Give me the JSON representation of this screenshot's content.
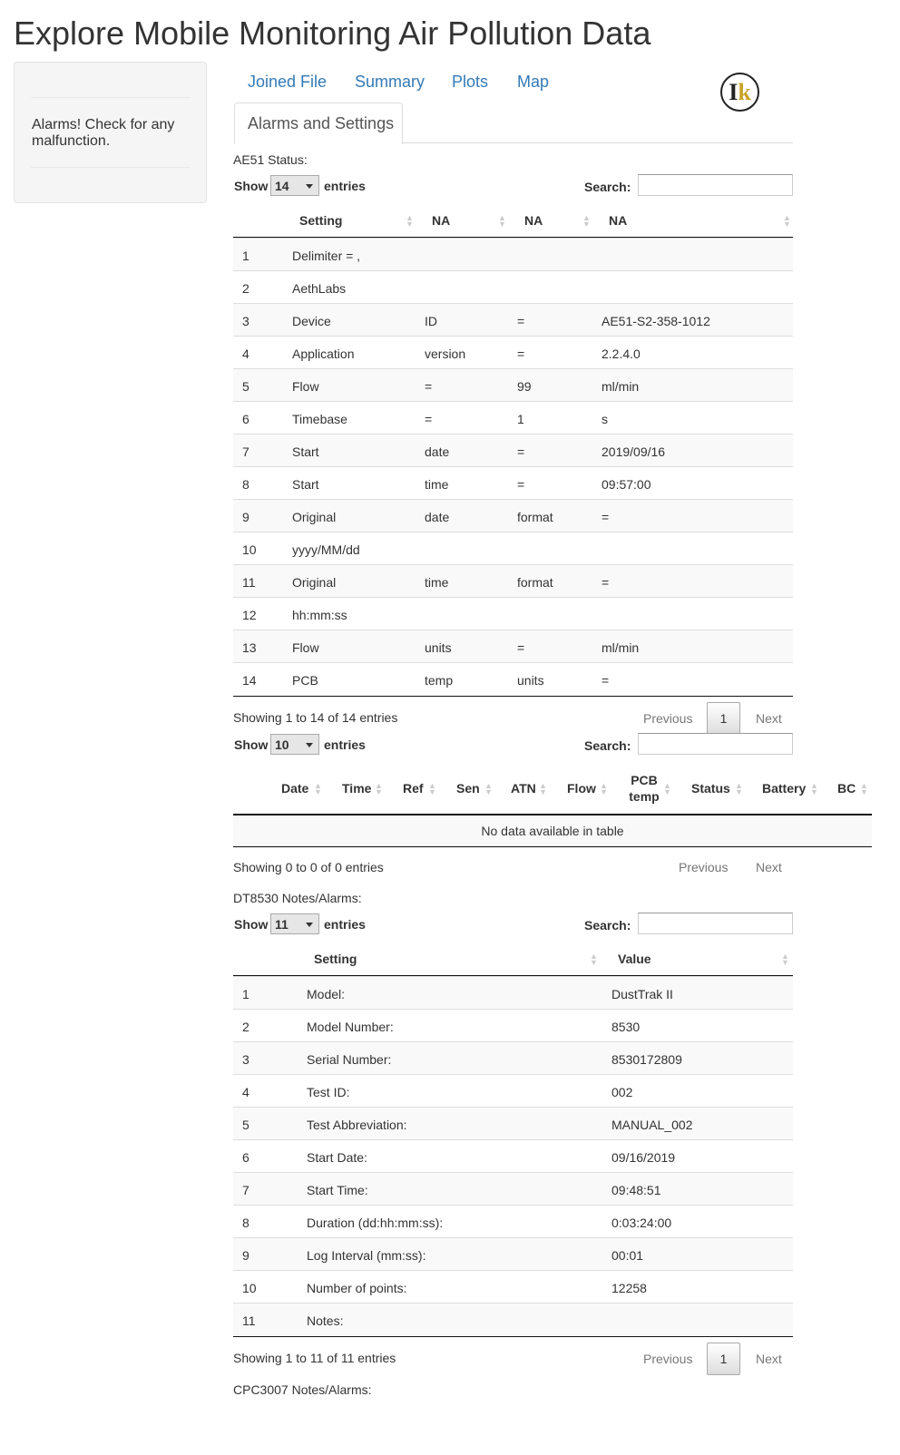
{
  "title": "Explore Mobile Monitoring Air Pollution Data",
  "sidebar": {
    "alarm_text": "Alarms! Check for any malfunction."
  },
  "nav": {
    "tabs": [
      "Joined File",
      "Summary",
      "Plots",
      "Map"
    ],
    "active_tab": "Alarms and Settings"
  },
  "labels": {
    "show": "Show",
    "entries": "entries",
    "search": "Search:",
    "previous": "Previous",
    "next": "Next",
    "page": "1"
  },
  "ae51": {
    "heading": "AE51 Status:",
    "page_length": "14",
    "columns": [
      "Setting",
      "NA",
      "NA",
      "NA"
    ],
    "rows": [
      [
        "1",
        "Delimiter = ,",
        "",
        "",
        ""
      ],
      [
        "2",
        "AethLabs",
        "",
        "",
        ""
      ],
      [
        "3",
        "Device",
        "ID",
        "=",
        "AE51-S2-358-1012"
      ],
      [
        "4",
        "Application",
        "version",
        "=",
        "2.2.4.0"
      ],
      [
        "5",
        "Flow",
        "=",
        "99",
        "ml/min"
      ],
      [
        "6",
        "Timebase",
        "=",
        "1",
        "s"
      ],
      [
        "7",
        "Start",
        "date",
        "=",
        "2019/09/16"
      ],
      [
        "8",
        "Start",
        "time",
        "=",
        "09:57:00"
      ],
      [
        "9",
        "Original",
        "date",
        "format",
        "="
      ],
      [
        "10",
        "yyyy/MM/dd",
        "",
        "",
        ""
      ],
      [
        "11",
        "Original",
        "time",
        "format",
        "="
      ],
      [
        "12",
        "hh:mm:ss",
        "",
        "",
        ""
      ],
      [
        "13",
        "Flow",
        "units",
        "=",
        "ml/min"
      ],
      [
        "14",
        "PCB",
        "temp",
        "units",
        "="
      ]
    ],
    "info": "Showing 1 to 14 of 14 entries"
  },
  "data_table": {
    "page_length": "10",
    "columns": [
      "Date",
      "Time",
      "Ref",
      "Sen",
      "ATN",
      "Flow",
      "PCB temp",
      "Status",
      "Battery",
      "BC"
    ],
    "empty": "No data available in table",
    "info": "Showing 0 to 0 of 0 entries"
  },
  "dt8530": {
    "heading": "DT8530 Notes/Alarms:",
    "page_length": "11",
    "columns": [
      "Setting",
      "Value"
    ],
    "rows": [
      [
        "1",
        "Model:",
        "DustTrak II"
      ],
      [
        "2",
        "Model Number:",
        "8530"
      ],
      [
        "3",
        "Serial Number:",
        "8530172809"
      ],
      [
        "4",
        "Test ID:",
        "002"
      ],
      [
        "5",
        "Test Abbreviation:",
        "MANUAL_002"
      ],
      [
        "6",
        "Start Date:",
        "09/16/2019"
      ],
      [
        "7",
        "Start Time:",
        "09:48:51"
      ],
      [
        "8",
        "Duration (dd:hh:mm:ss):",
        "0:03:24:00"
      ],
      [
        "9",
        "Log Interval (mm:ss):",
        "00:01"
      ],
      [
        "10",
        "Number of points:",
        "12258"
      ],
      [
        "11",
        "Notes:",
        ""
      ]
    ],
    "info": "Showing 1 to 11 of 11 entries"
  },
  "cpc3007": {
    "heading": "CPC3007 Notes/Alarms:"
  }
}
